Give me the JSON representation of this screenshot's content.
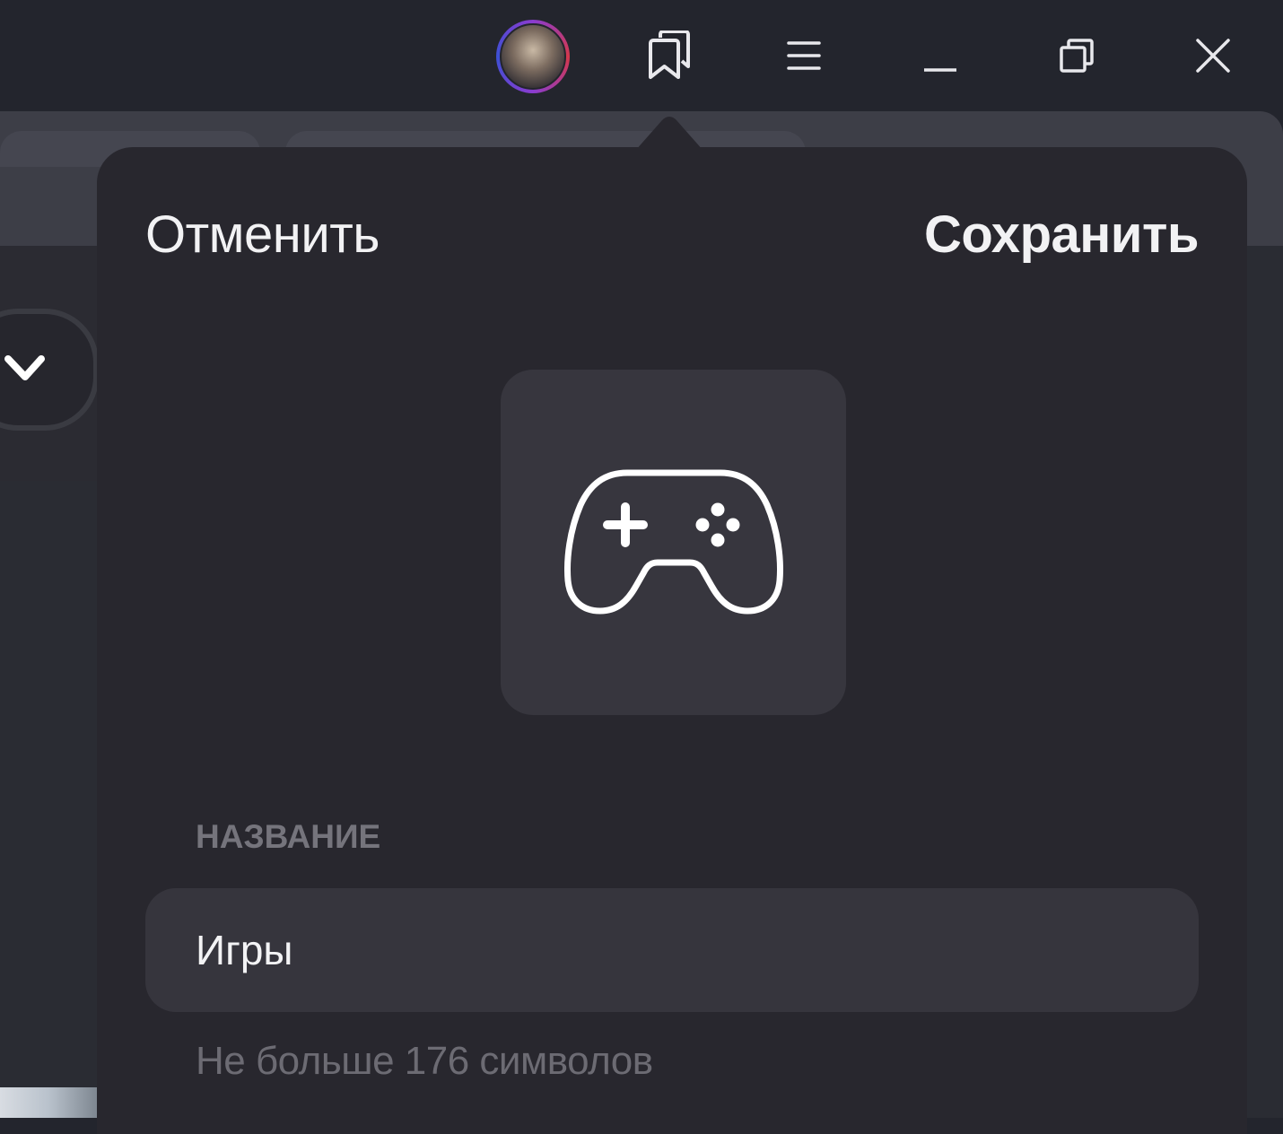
{
  "titlebar": {
    "icons": [
      "avatar",
      "bookmarks-icon",
      "menu-icon",
      "minimize-icon",
      "restore-icon",
      "close-icon"
    ]
  },
  "dialog": {
    "cancel_label": "Отменить",
    "save_label": "Сохранить",
    "selected_icon": "gamepad-icon",
    "name_label": "НАЗВАНИЕ",
    "name_value": "Игры",
    "hint": "Не больше 176 символов"
  },
  "colors": {
    "titlebar_bg": "#23252d",
    "popup_bg": "#28272e",
    "tile_bg": "#37363e",
    "text_primary": "#f2f2f4",
    "text_muted": "#75747c"
  }
}
